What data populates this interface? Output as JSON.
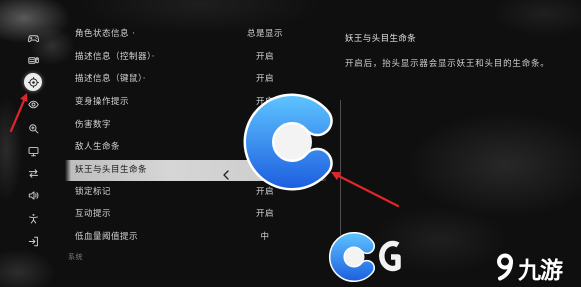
{
  "sidebar": {
    "items": [
      {
        "icon": "gamepad-icon",
        "selected": false
      },
      {
        "icon": "keyboard-mouse-icon",
        "selected": false
      },
      {
        "icon": "hud-target-icon",
        "selected": true
      },
      {
        "icon": "eye-icon",
        "selected": false
      },
      {
        "icon": "zoom-icon",
        "selected": false
      },
      {
        "icon": "monitor-icon",
        "selected": false
      },
      {
        "icon": "swap-arrows-icon",
        "selected": false
      },
      {
        "icon": "speaker-icon",
        "selected": false
      },
      {
        "icon": "accessibility-icon",
        "selected": false
      },
      {
        "icon": "exit-icon",
        "selected": false
      }
    ]
  },
  "settings": {
    "rows": [
      {
        "label": "角色状态信息 ·",
        "value": "总是显示"
      },
      {
        "label": "描述信息（控制器）·",
        "value": "开启"
      },
      {
        "label": "描述信息（键鼠）·",
        "value": "开启"
      },
      {
        "label": "变身操作提示",
        "value": "开启"
      },
      {
        "label": "伤害数字"
      },
      {
        "label": "敌人生命条"
      },
      {
        "label": "妖王与头目生命条",
        "selected": true,
        "prev_icon": "chevron-left-icon"
      },
      {
        "label": "锁定标记",
        "value": "开启"
      },
      {
        "label": "互动提示",
        "value": "开启"
      },
      {
        "label": "低血量阈值提示",
        "value": "中"
      }
    ],
    "section_header": "系统"
  },
  "detail": {
    "title": "妖王与头目生命条",
    "description": "开启后，抬头显示器会显示妖王和头目的生命条。"
  },
  "watermark": {
    "brand_text": "九游",
    "logos": [
      "c-logo-icon",
      "c-logo-icon",
      "brand-mark-icon",
      "jiuyou-logo-icon"
    ]
  },
  "colors": {
    "background": "#0f0f0f",
    "text": "#d4d4d4",
    "selected_row_bg": "#d6d6d6",
    "selected_row_text": "#161616",
    "selected_tab_bg": "#ececec",
    "icon": "#cfcfcf",
    "logo_blue_light": "#5ec3ff",
    "logo_blue_dark": "#1d5fe0",
    "annotation_red": "#e0262a"
  }
}
